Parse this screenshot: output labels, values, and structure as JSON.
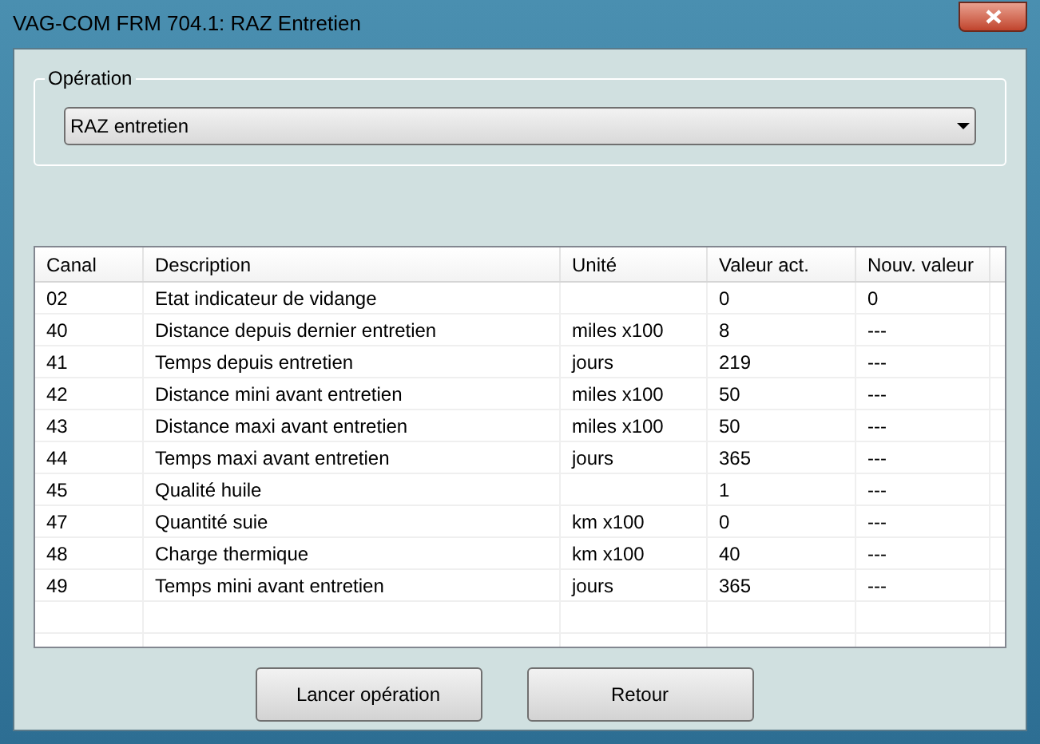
{
  "window": {
    "title": "VAG-COM FRM 704.1:  RAZ Entretien"
  },
  "operation": {
    "label": "Opération",
    "value": "RAZ entretien"
  },
  "table": {
    "columns": [
      "Canal",
      "Description",
      "Unité",
      "Valeur act.",
      "Nouv. valeur"
    ],
    "rows": [
      [
        "02",
        "Etat indicateur de vidange",
        "",
        "0",
        "0"
      ],
      [
        "40",
        "Distance depuis dernier entretien",
        "miles x100",
        "8",
        "---"
      ],
      [
        "41",
        "Temps depuis entretien",
        "jours",
        "219",
        "---"
      ],
      [
        "42",
        "Distance mini avant entretien",
        "miles x100",
        "50",
        "---"
      ],
      [
        "43",
        "Distance maxi avant entretien",
        "miles x100",
        "50",
        "---"
      ],
      [
        "44",
        "Temps maxi avant entretien",
        "jours",
        "365",
        "---"
      ],
      [
        "45",
        "Qualité huile",
        "",
        "1",
        "---"
      ],
      [
        "47",
        "Quantité suie",
        "km x100",
        "0",
        "---"
      ],
      [
        "48",
        "Charge thermique",
        "km x100",
        "40",
        "---"
      ],
      [
        "49",
        "Temps mini avant entretien",
        "jours",
        "365",
        "---"
      ]
    ]
  },
  "buttons": [
    "Lancer opération",
    "Retour"
  ]
}
